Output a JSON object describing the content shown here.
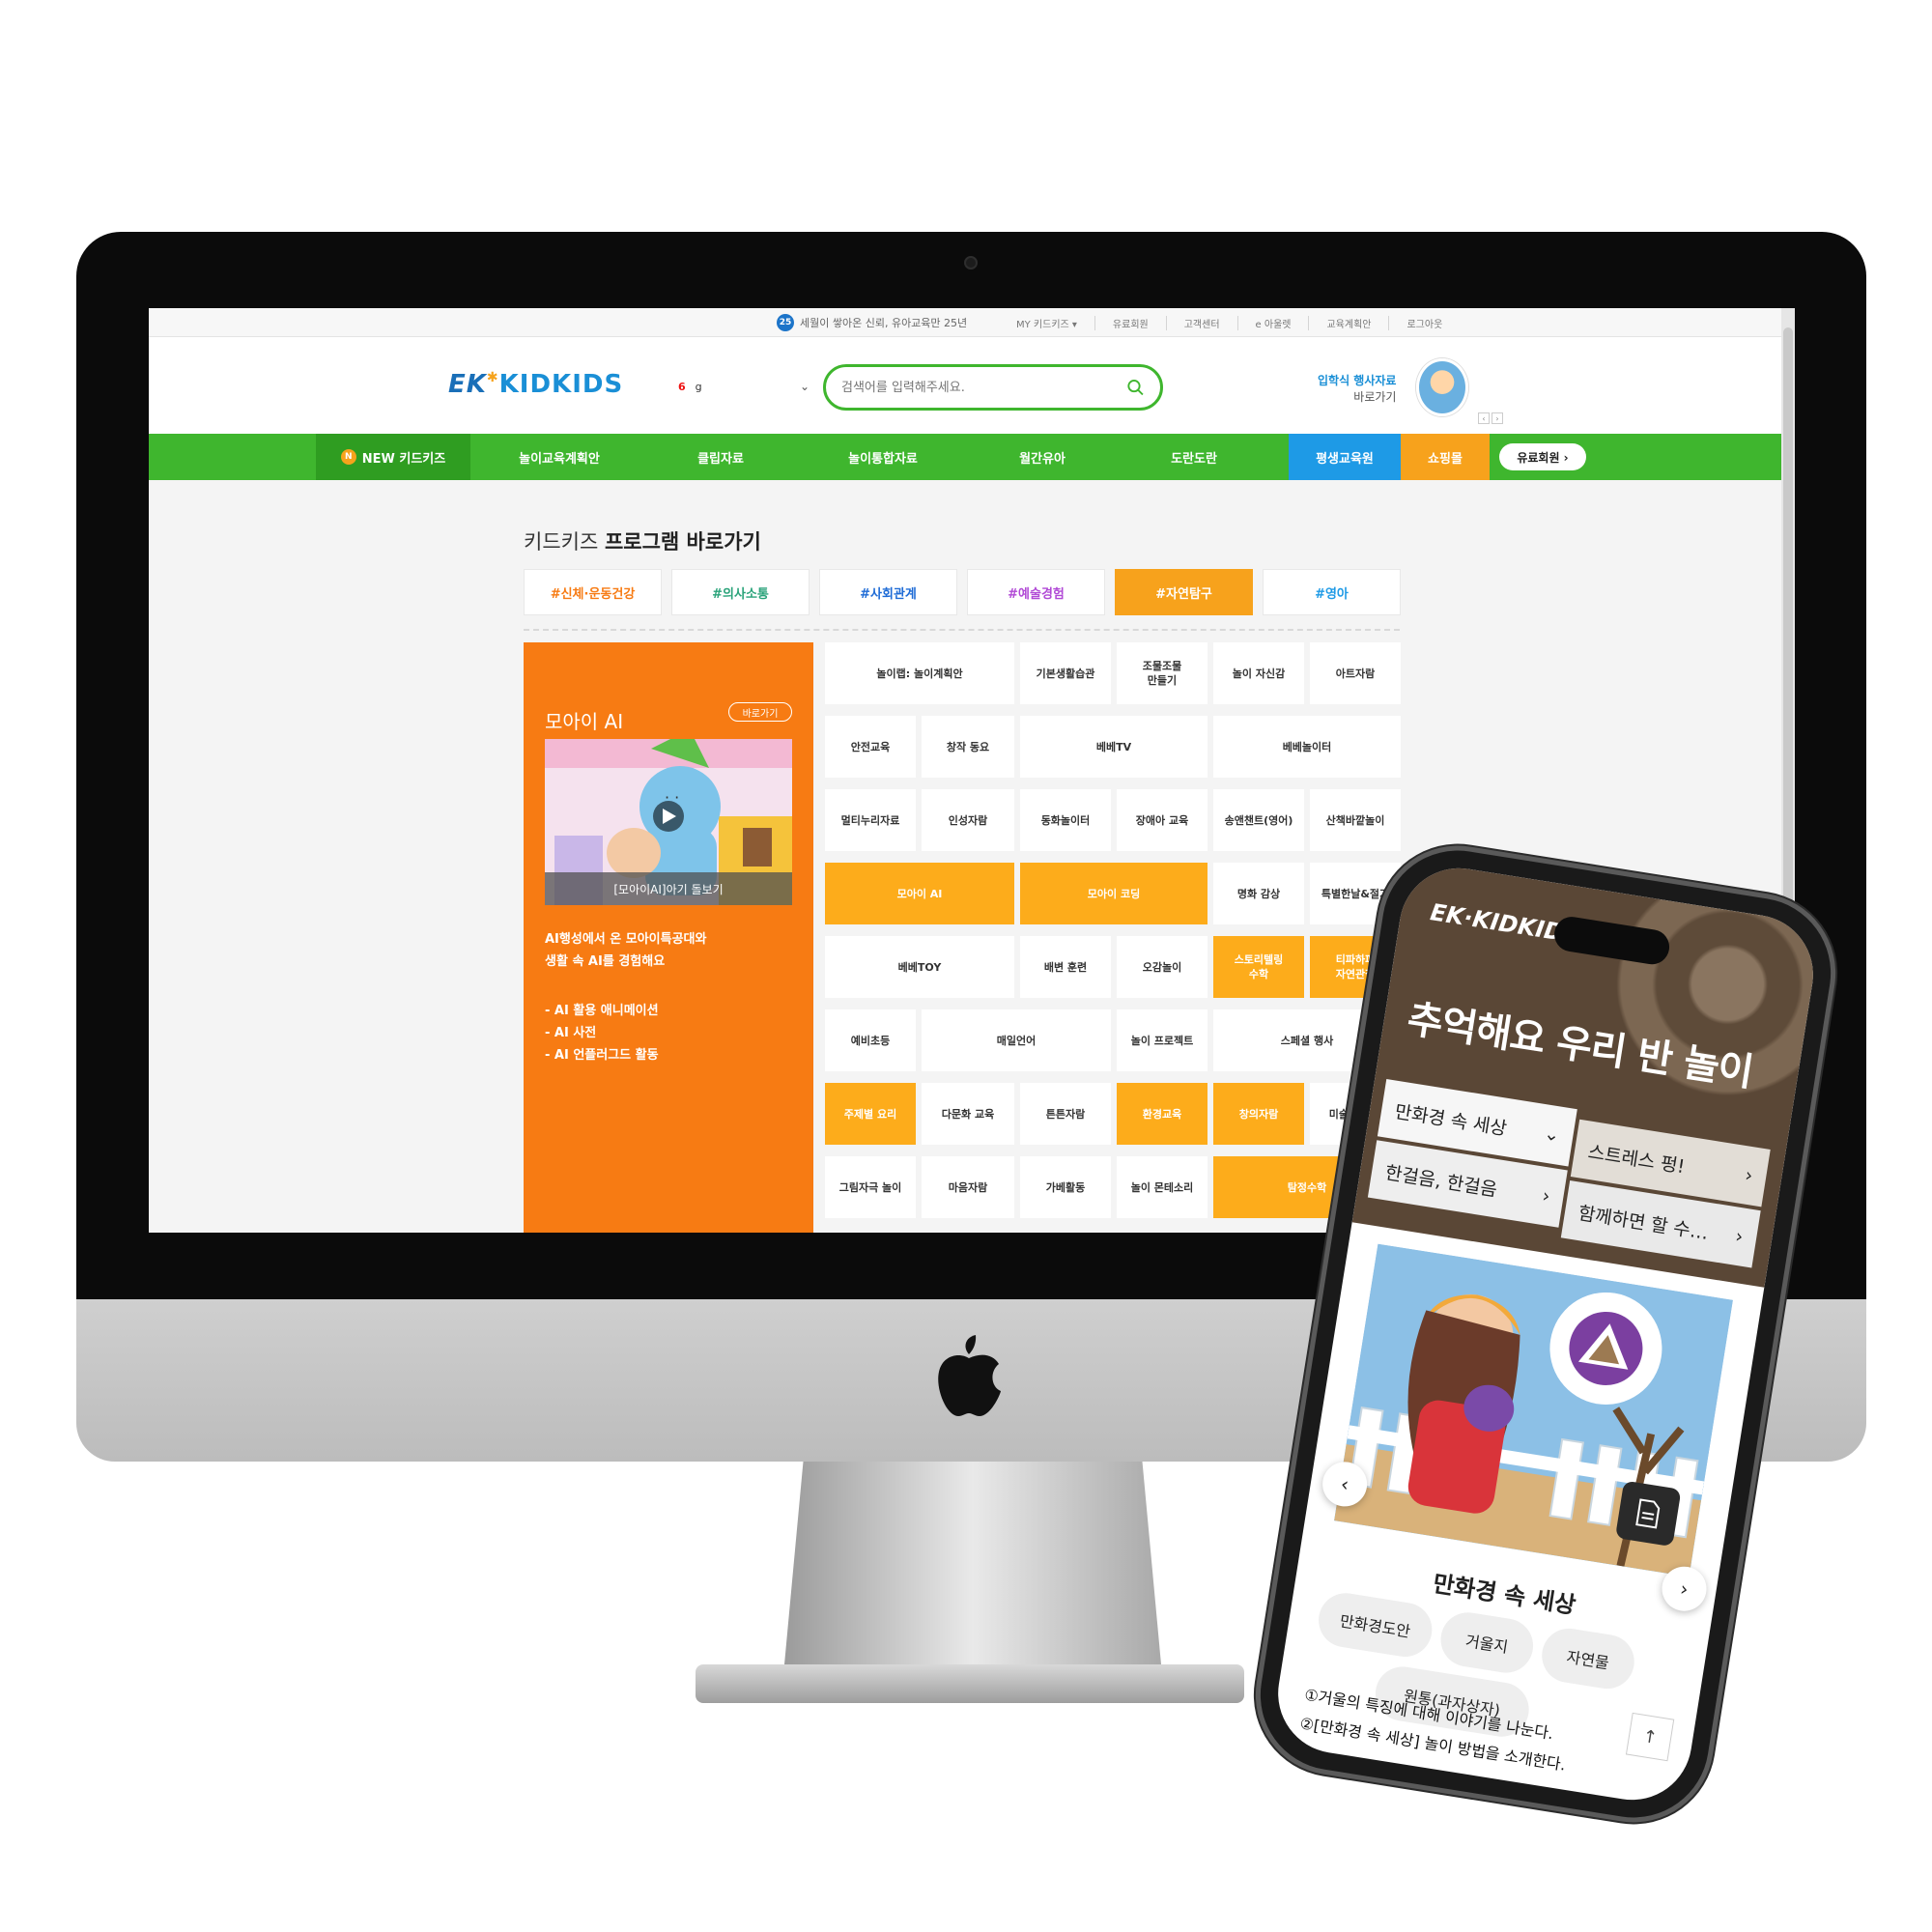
{
  "desktop": {
    "utility_bar": {
      "promo_badge": "25",
      "promo_text": "세월이 쌓아온 신뢰, 유아교육만 25년",
      "links": [
        "MY 키드키즈 ▾",
        "유료회원",
        "고객센터",
        "e 아울렛",
        "교육계획안",
        "로그아웃"
      ]
    },
    "header": {
      "logo_ek": "EK",
      "logo_text": "KIDKIDS",
      "select_number": "6",
      "select_value": "g",
      "search_placeholder": "검색어를 입력해주세요.",
      "promo_title": "입학식 행사자료",
      "promo_sub": "바로가기"
    },
    "gnb": {
      "new_badge": "N",
      "items": [
        "NEW 키드키즈",
        "놀이교육계획안",
        "클립자료",
        "놀이통합자료",
        "월간유아",
        "도란도란",
        "평생교육원",
        "쇼핑몰"
      ],
      "pay_button": "유료회원 ›"
    },
    "program": {
      "title_light": "키드키즈 ",
      "title_bold": "프로그램 바로가기",
      "hashtags": [
        {
          "label": "#신체·운동건강",
          "color": "#f77b13"
        },
        {
          "label": "#의사소통",
          "color": "#2aa37a"
        },
        {
          "label": "#사회관계",
          "color": "#1e6bd6"
        },
        {
          "label": "#예술경험",
          "color": "#b14ad6"
        },
        {
          "label": "#자연탐구",
          "color": "#ffffff",
          "active": true
        },
        {
          "label": "#영아",
          "color": "#1e9ae6"
        }
      ]
    },
    "moai": {
      "title": "모아이 AI",
      "shortcut": "바로가기",
      "video_caption": "[모아이AI]아기 돌보기",
      "desc_1": "AI행성에서 온 모아이특공대와",
      "desc_2": "생활 속 AI를 경험해요",
      "bullet_1": "- AI 활용 애니메이션",
      "bullet_2": "- AI 사전",
      "bullet_3": "- AI 언플러그드 활동"
    },
    "grid": {
      "c1": "놀이랩: 놀이계획안",
      "c2": "기본생활습관",
      "c3": "조물조물\n만들기",
      "c4": "놀이 자신감",
      "c5": "아트자람",
      "c6": "안전교육",
      "c7": "창작 동요",
      "c8": "베베TV",
      "c9": "베베놀이터",
      "c10": "멀티누리자료",
      "c11": "인성자람",
      "c12": "동화놀이터",
      "c13": "장애아 교육",
      "c14": "송앤챈트(영어)",
      "c15": "산책바깥놀이",
      "c16": "모아이 AI",
      "c17": "모아이 코딩",
      "c18": "명화 감상",
      "c19": "특별한날&절기",
      "c20": "베베TOY",
      "c21": "배변 훈련",
      "c22": "오감놀이",
      "c23": "스토리텔링\n수학",
      "c24": "티파하파\n자연관찰",
      "c25": "예비초등",
      "c26": "매일언어",
      "c27": "놀이 프로젝트",
      "c28": "스페셜 행사",
      "c29": "주제별 요리",
      "c30": "다문화 교육",
      "c31": "튼튼자람",
      "c32": "환경교육",
      "c33": "창의자람",
      "c34": "미술아 놀자",
      "c35": "그림자극 놀이",
      "c36": "마음자람",
      "c37": "가베활동",
      "c38": "놀이 몬테소리",
      "c39": "탐정수학"
    }
  },
  "mobile": {
    "logo": "EK·KIDKIDS",
    "hero_title": "추억해요 우리 반 놀이",
    "menu": [
      {
        "label": "만화경 속 세상",
        "icon": "chevron-down-icon"
      },
      {
        "label": "스트레스 펑!",
        "icon": "chevron-right-icon"
      },
      {
        "label": "한걸음, 한걸음",
        "icon": "chevron-right-icon"
      },
      {
        "label": "함께하면 할 수…",
        "icon": "chevron-right-icon"
      }
    ],
    "subtitle": "만화경 속 세상",
    "chips": [
      "만화경도안",
      "거울지",
      "자연물",
      "원통(과자상자)"
    ],
    "step_1": "①거울의 특징에 대해 이야기를 나눈다.",
    "step_2": "②[만화경 속 세상] 놀이 방법을 소개한다.",
    "prev": "‹",
    "next": "›",
    "top": "↑"
  },
  "colors": {
    "green": "#3fb62e",
    "orange": "#f77b13",
    "yellow": "#fdac1b",
    "blue": "#1e9ae6"
  }
}
